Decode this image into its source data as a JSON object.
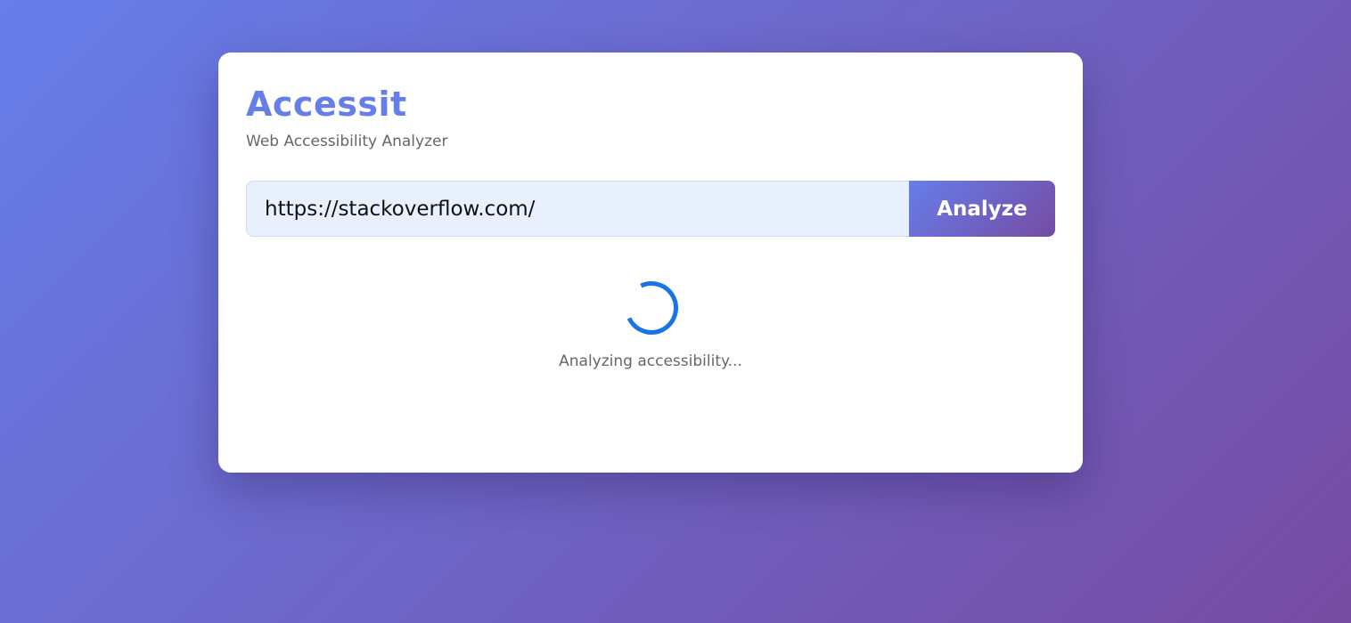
{
  "app": {
    "title": "Accessit",
    "subtitle": "Web Accessibility Analyzer"
  },
  "search": {
    "url_value": "https://stackoverflow.com/",
    "button_label": "Analyze"
  },
  "status": {
    "spinner_icon": "loading-spinner",
    "spinner_color": "#1a73e8",
    "message": "Analyzing accessibility..."
  },
  "colors": {
    "accent": "#667eea",
    "gradient_end": "#764ba2"
  }
}
